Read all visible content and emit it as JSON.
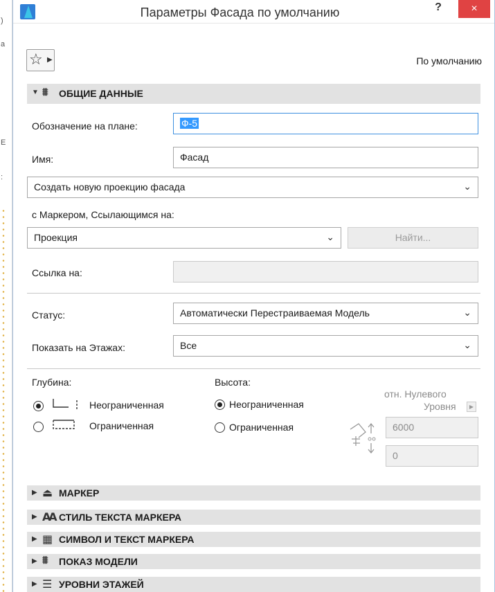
{
  "window": {
    "title": "Параметры Фасада по умолчанию",
    "help": "?",
    "close": "×"
  },
  "toolbar": {
    "favorites_icon": "star-icon",
    "preset_label": "По умолчанию"
  },
  "sections": {
    "general": "ОБЩИЕ ДАННЫЕ",
    "marker": "МАРКЕР",
    "marker_text_style": "СТИЛЬ ТЕКСТА МАРКЕРА",
    "marker_symbol_text": "СИМВОЛ И ТЕКСТ МАРКЕРА",
    "model_display": "ПОКАЗ МОДЕЛИ",
    "story_levels": "УРОВНИ ЭТАЖЕЙ"
  },
  "general": {
    "plan_id_label": "Обозначение на плане:",
    "plan_id_value": "Ф-5",
    "name_label": "Имя:",
    "name_value": "Фасад",
    "create_mode": "Создать новую проекцию фасада",
    "marker_ref_label": "с Маркером, Ссылающимся на:",
    "marker_ref_value": "Проекция",
    "find_button": "Найти...",
    "link_label": "Ссылка на:",
    "link_value": "",
    "status_label": "Статус:",
    "status_value": "Автоматически Перестраиваемая Модель",
    "show_on_stories_label": "Показать на Этажах:",
    "show_on_stories_value": "Все"
  },
  "depth": {
    "label": "Глубина:",
    "unlimited": "Неограниченная",
    "limited": "Ограниченная",
    "selected": "unlimited"
  },
  "height": {
    "label": "Высота:",
    "unlimited": "Неограниченная",
    "limited": "Ограниченная",
    "selected": "unlimited",
    "reference_line1": "отн. Нулевого",
    "reference_line2": "Уровня",
    "top_value": "6000",
    "bottom_value": "0"
  },
  "colors": {
    "close_button": "#e04343",
    "section_header": "#e2e2e2",
    "selection": "#3399ff"
  }
}
